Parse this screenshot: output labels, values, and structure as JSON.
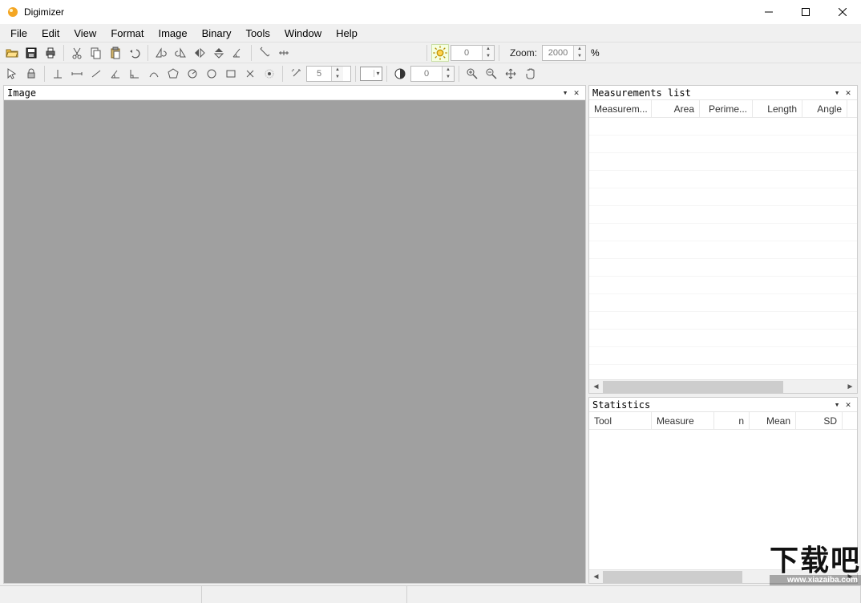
{
  "app": {
    "title": "Digimizer"
  },
  "menu": [
    "File",
    "Edit",
    "View",
    "Format",
    "Image",
    "Binary",
    "Tools",
    "Window",
    "Help"
  ],
  "toolbar1": {
    "brightness_spin": "0",
    "zoom_label": "Zoom:",
    "zoom_value": "2000",
    "zoom_suffix": "%"
  },
  "toolbar2": {
    "size_spin": "5",
    "contrast_spin": "0"
  },
  "panels": {
    "image": {
      "title": "Image"
    },
    "measurements": {
      "title": "Measurements list",
      "columns": [
        "Measurem...",
        "Area",
        "Perime...",
        "Length",
        "Angle"
      ]
    },
    "statistics": {
      "title": "Statistics",
      "columns": [
        "Tool",
        "Measure",
        "n",
        "Mean",
        "SD"
      ]
    }
  },
  "watermark": {
    "big": "下载吧",
    "small": "www.xiazaiba.com"
  }
}
